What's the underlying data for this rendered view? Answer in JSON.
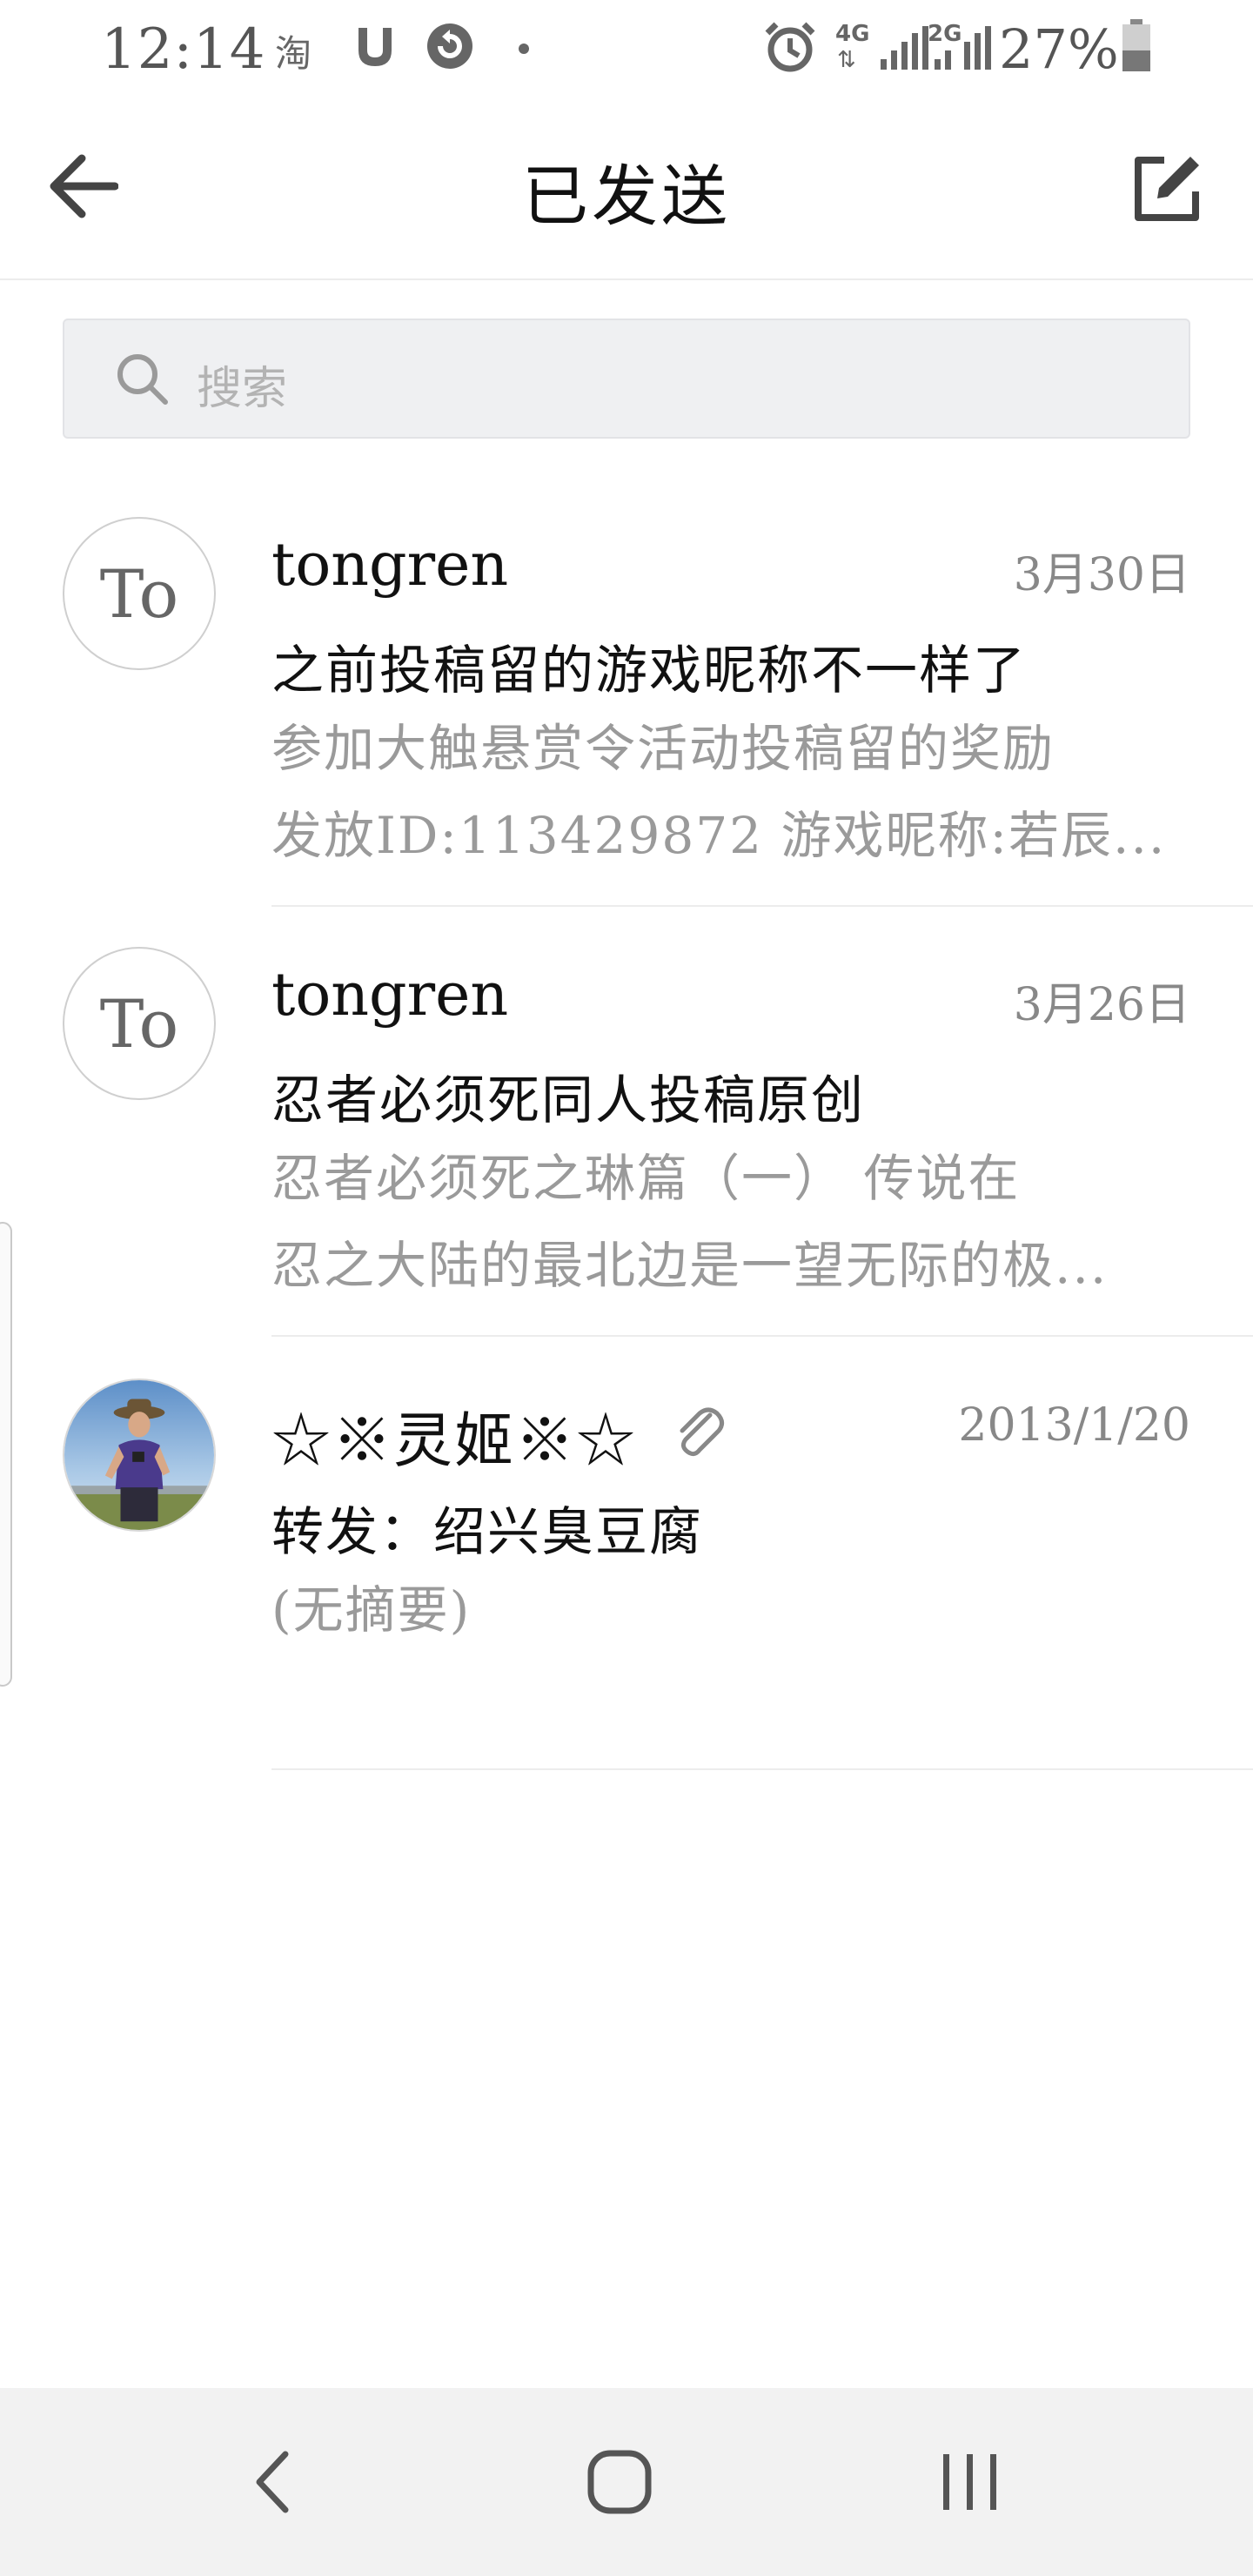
{
  "status_bar": {
    "time": "12:14",
    "taobao_glyph": "淘",
    "icons": [
      "taobao-icon",
      "gesture-icon",
      "sync-icon",
      "alarm-icon",
      "4g-signal-icon",
      "2g-signal-icon",
      "battery-icon"
    ],
    "network_4g": "4G",
    "network_2g": "2G",
    "battery": "27%"
  },
  "header": {
    "title": "已发送",
    "back_icon": "arrow-left-icon",
    "compose_icon": "compose-icon"
  },
  "search": {
    "placeholder": "搜索",
    "icon": "search-icon"
  },
  "mails": [
    {
      "avatar_text": "To",
      "sender": "tongren",
      "date": "3月30日",
      "subject": "之前投稿留的游戏昵称不一样了",
      "preview_line1": "参加大触悬赏令活动投稿留的奖励",
      "preview_line2": "发放ID:113429872 游戏昵称:若辰..."
    },
    {
      "avatar_text": "To",
      "sender": "tongren",
      "date": "3月26日",
      "subject": "忍者必须死同人投稿原创",
      "preview_line1": "忍者必须死之琳篇（一） 传说在",
      "preview_line2": "忍之大陆的最北边是一望无际的极..."
    },
    {
      "avatar_icon": "person-photo",
      "sender": "☆※灵姬※☆",
      "has_attachment": true,
      "attachment_icon": "paperclip-icon",
      "date": "2013/1/20",
      "subject": "转发：绍兴臭豆腐",
      "preview_line1": "(无摘要)"
    }
  ],
  "nav_bar": {
    "buttons": [
      "back-nav-icon",
      "home-nav-icon",
      "recents-nav-icon"
    ]
  },
  "colors": {
    "background": "#ffffff",
    "search_bg": "#eff0f2",
    "muted_text": "#9a9a9a",
    "date_text": "#888888",
    "nav_bg": "#f2f2f2"
  }
}
